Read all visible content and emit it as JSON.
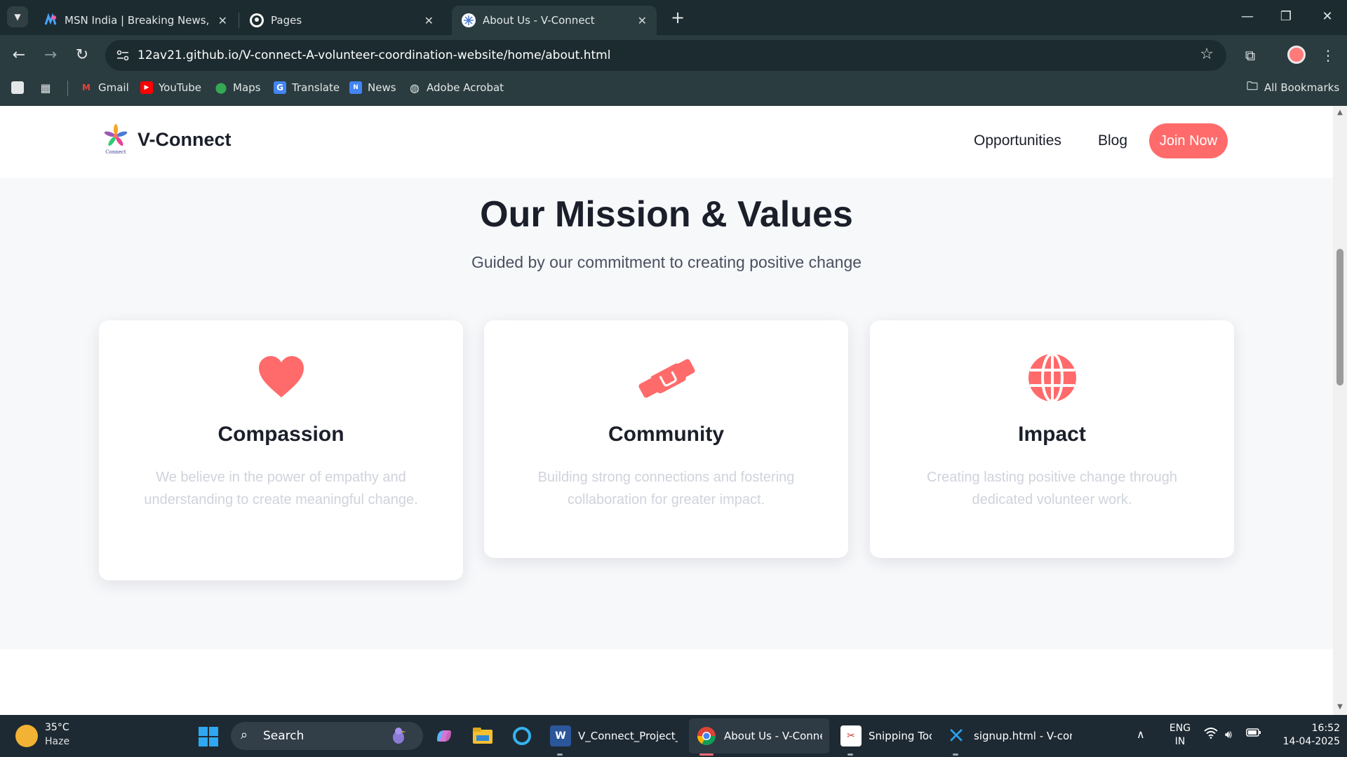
{
  "browser": {
    "tabs": [
      {
        "title": "MSN India | Breaking News, Ent",
        "icon": "msn-icon"
      },
      {
        "title": "Pages",
        "icon": "github-icon"
      },
      {
        "title": "About Us - V-Connect",
        "icon": "vconnect-icon",
        "active": true
      }
    ],
    "url": "12av21.github.io/V-connect-A-volunteer-coordination-website/home/about.html",
    "bookmarks": [
      {
        "label": "Gmail",
        "icon": "gmail-icon"
      },
      {
        "label": "YouTube",
        "icon": "youtube-icon"
      },
      {
        "label": "Maps",
        "icon": "maps-icon"
      },
      {
        "label": "Translate",
        "icon": "translate-icon"
      },
      {
        "label": "News",
        "icon": "news-icon"
      },
      {
        "label": "Adobe Acrobat",
        "icon": "acrobat-icon"
      }
    ],
    "all_bookmarks": "All Bookmarks"
  },
  "site": {
    "brand": "V-Connect",
    "logo_caption": "Connect",
    "nav": {
      "opportunities": "Opportunities",
      "blog": "Blog",
      "join": "Join Now"
    },
    "accent_color": "#ff6b6b"
  },
  "section": {
    "title": "Our Mission & Values",
    "subtitle": "Guided by our commitment to creating positive change",
    "cards": [
      {
        "title": "Compassion",
        "icon": "heart-icon",
        "description": "We believe in the power of empathy and understanding to create meaningful change."
      },
      {
        "title": "Community",
        "icon": "handshake-icon",
        "description": "Building strong connections and fostering collaboration for greater impact."
      },
      {
        "title": "Impact",
        "icon": "globe-icon",
        "description": "Creating lasting positive change through dedicated volunteer work."
      }
    ]
  },
  "taskbar": {
    "weather": {
      "temp": "35°C",
      "desc": "Haze"
    },
    "search": "Search",
    "apps": [
      {
        "label": "V_Connect_Project_R",
        "icon": "word-icon"
      },
      {
        "label": "About Us - V-Connec",
        "icon": "chrome-icon",
        "active": true
      },
      {
        "label": "Snipping Toc",
        "icon": "snipping-tool-icon"
      },
      {
        "label": "signup.html - V-conn",
        "icon": "vscode-icon"
      }
    ],
    "lang": {
      "line1": "ENG",
      "line2": "IN"
    },
    "time": "16:52",
    "date": "14-04-2025"
  }
}
